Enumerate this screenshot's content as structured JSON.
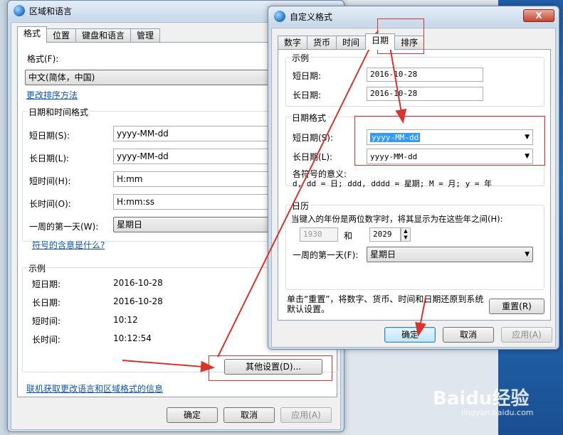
{
  "left_window": {
    "title": "区域和语言",
    "tabs": [
      "格式",
      "位置",
      "键盘和语言",
      "管理"
    ],
    "format_label": "格式(F):",
    "format_value": "中文(简体，中国)",
    "change_sort_link": "更改排序方法",
    "datetime_group": "日期和时间格式",
    "rows": [
      {
        "label": "短日期(S):",
        "value": "yyyy-MM-dd"
      },
      {
        "label": "长日期(L):",
        "value": "yyyy-MM-dd"
      },
      {
        "label": "短时间(H):",
        "value": "H:mm"
      },
      {
        "label": "长时间(O):",
        "value": "H:mm:ss"
      },
      {
        "label": "一周的第一天(W):",
        "value": "星期日"
      }
    ],
    "symbol_link": "符号的含意是什么?",
    "example_group": "示例",
    "examples": [
      {
        "label": "短日期:",
        "value": "2016-10-28"
      },
      {
        "label": "长日期:",
        "value": "2016-10-28"
      },
      {
        "label": "短时间:",
        "value": "10:12"
      },
      {
        "label": "长时间:",
        "value": "10:12:54"
      }
    ],
    "other_settings_button": "其他设置(D)...",
    "online_link": "联机获取更改语言和区域格式的信息",
    "ok": "确定",
    "cancel": "取消",
    "apply": "应用(A)"
  },
  "right_window": {
    "title": "自定义格式",
    "close": "X",
    "tabs": [
      "数字",
      "货币",
      "时间",
      "日期",
      "排序"
    ],
    "example_group": "示例",
    "examples": [
      {
        "label": "短日期:",
        "value": "2016-10-28"
      },
      {
        "label": "长日期:",
        "value": "2016-10-28"
      }
    ],
    "date_format_group": "日期格式",
    "date_rows": [
      {
        "label": "短日期(S):",
        "value": "yyyy-MM-dd"
      },
      {
        "label": "长日期(L):",
        "value": "yyyy-MM-dd"
      }
    ],
    "symbols_title": "各符号的意义:",
    "symbols_text": "d, dd = 日;  ddd, dddd = 星期;  M = 月;  y = 年",
    "calendar_group": "日历",
    "two_digit_text": "当键入的年份是两位数字时，将其显示为在这些年之间(H):",
    "year_from": "1930",
    "year_and": "和",
    "year_to": "2029",
    "first_day_label": "一周的第一天(F):",
    "first_day_value": "星期日",
    "reset_text": "单击“重置”，将数字、货币、时间和日期还原到系统默认设置。",
    "reset_button": "重置(R)",
    "ok": "确定",
    "cancel": "取消",
    "apply": "应用(A)"
  },
  "watermark": {
    "brand": "Baidu经验",
    "url": "jingyan.baidu.com"
  },
  "colors": {
    "annotation_red": "#d9332b",
    "link_blue": "#0d56b3",
    "selection_blue": "#3399ff"
  }
}
